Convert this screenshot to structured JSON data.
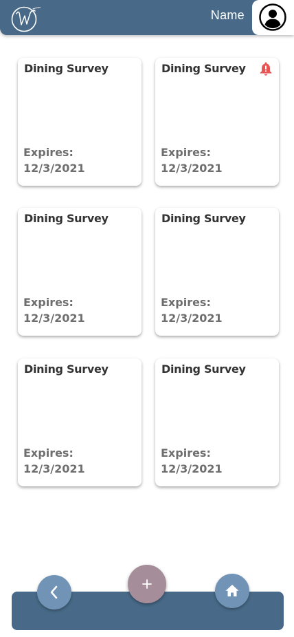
{
  "header": {
    "name_label": "Name"
  },
  "cards": [
    {
      "title": "Dining Survey",
      "expires_label": "Expires:",
      "expires_date": "12/3/2021",
      "alert": false
    },
    {
      "title": "Dining Survey",
      "expires_label": "Expires:",
      "expires_date": "12/3/2021",
      "alert": true
    },
    {
      "title": "Dining Survey",
      "expires_label": "Expires:",
      "expires_date": "12/3/2021",
      "alert": false
    },
    {
      "title": "Dining Survey",
      "expires_label": "Expires:",
      "expires_date": "12/3/2021",
      "alert": false
    },
    {
      "title": "Dining Survey",
      "expires_label": "Expires:",
      "expires_date": "12/3/2021",
      "alert": false
    },
    {
      "title": "Dining Survey",
      "expires_label": "Expires:",
      "expires_date": "12/3/2021",
      "alert": false
    }
  ],
  "icons": {
    "logo": "script-w-logo-icon",
    "avatar": "user-avatar-icon",
    "alert": "bell-alert-icon",
    "back": "chevron-left-icon",
    "add": "plus-icon",
    "home": "home-icon"
  },
  "colors": {
    "primary": "#486a88",
    "nav_button": "#7193b5",
    "add_button": "#a58e9a",
    "alert": "#e85555",
    "card_title": "#333333",
    "card_expires": "#6e6e6e"
  }
}
